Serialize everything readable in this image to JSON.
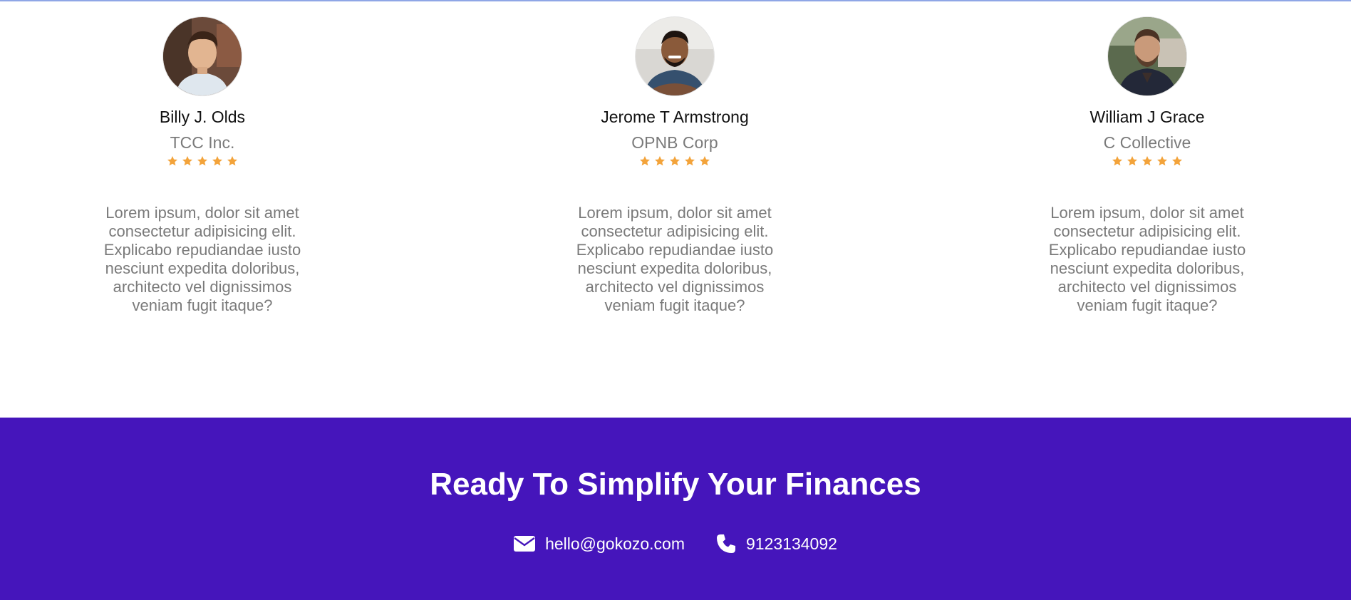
{
  "testimonials": [
    {
      "name": "Billy J. Olds",
      "company": "TCC Inc.",
      "rating": 5,
      "quote": "Lorem ipsum, dolor sit amet consectetur adipisicing elit. Explicabo repudiandae iusto nesciunt expedita doloribus, architecto vel dignissimos veniam fugit itaque?"
    },
    {
      "name": "Jerome T Armstrong",
      "company": "OPNB Corp",
      "rating": 5,
      "quote": "Lorem ipsum, dolor sit amet consectetur adipisicing elit. Explicabo repudiandae iusto nesciunt expedita doloribus, architecto vel dignissimos veniam fugit itaque?"
    },
    {
      "name": "William J Grace",
      "company": "C Collective",
      "rating": 5,
      "quote": "Lorem ipsum, dolor sit amet consectetur adipisicing elit. Explicabo repudiandae iusto nesciunt expedita doloribus, architecto vel dignissimos veniam fugit itaque?"
    }
  ],
  "cta": {
    "title": "Ready To Simplify Your Finances",
    "email": "hello@gokozo.com",
    "phone": "9123134092",
    "email_icon": "envelope-icon",
    "phone_icon": "phone-icon"
  },
  "colors": {
    "cta_background": "#4515bb",
    "star": "#f3a33a",
    "muted_text": "#7a7a7a"
  }
}
